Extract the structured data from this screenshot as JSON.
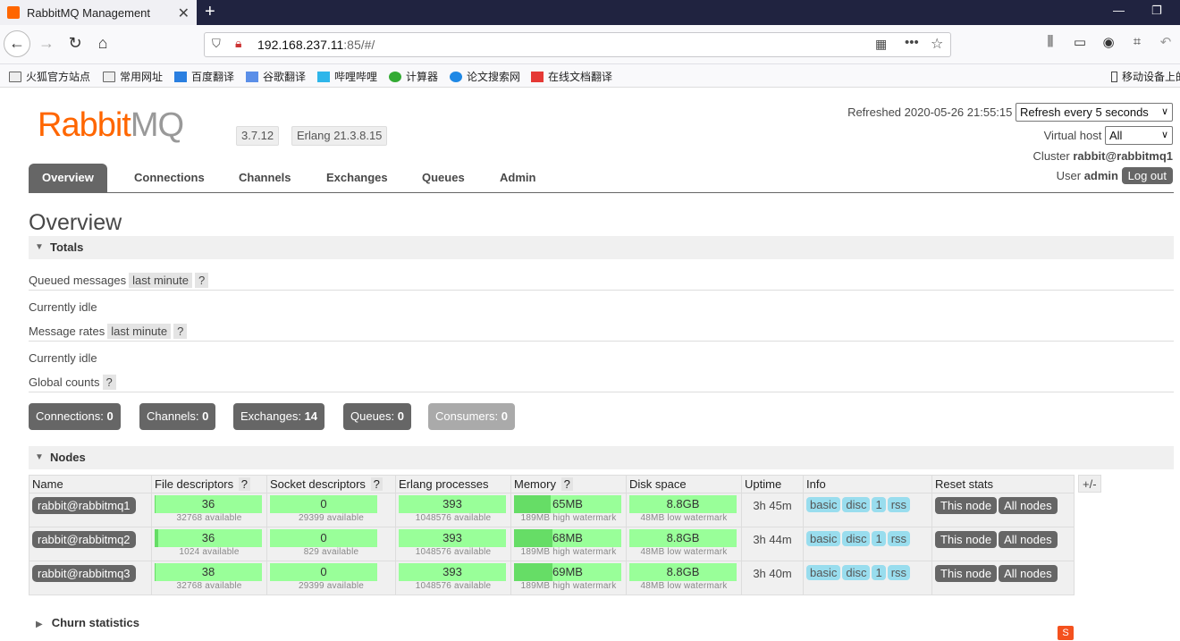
{
  "browser": {
    "tab_title": "RabbitMQ Management",
    "url_host": "192.168.237.11",
    "url_rest": ":85/#/",
    "bookmarks": [
      "火狐官方站点",
      "常用网址",
      "百度翻译",
      "谷歌翻译",
      "哔哩哔哩",
      "计算器",
      "论文搜索网",
      "在线文档翻译"
    ],
    "mobile_bookmarks": "移动设备上的"
  },
  "header": {
    "logo_rabbit": "Rabbit",
    "logo_mq": "MQ",
    "version": "3.7.12",
    "erlang": "Erlang 21.3.8.15",
    "refreshed": "Refreshed 2020-05-26 21:55:15",
    "refresh_select": "Refresh every 5 seconds",
    "vhost_label": "Virtual host",
    "vhost_value": "All",
    "cluster_label": "Cluster",
    "cluster_value": "rabbit@rabbitmq1",
    "user_label": "User",
    "user_value": "admin",
    "logout": "Log out"
  },
  "tabs": [
    "Overview",
    "Connections",
    "Channels",
    "Exchanges",
    "Queues",
    "Admin"
  ],
  "page_title": "Overview",
  "totals": {
    "title": "Totals",
    "queued_label": "Queued messages",
    "queued_hint": "last minute",
    "idle1": "Currently idle",
    "rates_label": "Message rates",
    "rates_hint": "last minute",
    "idle2": "Currently idle",
    "global_label": "Global counts",
    "help": "?"
  },
  "counts": [
    {
      "label": "Connections:",
      "value": "0"
    },
    {
      "label": "Channels:",
      "value": "0"
    },
    {
      "label": "Exchanges:",
      "value": "14"
    },
    {
      "label": "Queues:",
      "value": "0"
    },
    {
      "label": "Consumers:",
      "value": "0"
    }
  ],
  "nodes": {
    "title": "Nodes",
    "headers": [
      "Name",
      "File descriptors",
      "Socket descriptors",
      "Erlang processes",
      "Memory",
      "Disk space",
      "Uptime",
      "Info",
      "Reset stats"
    ],
    "plusminus": "+/-",
    "info_pills": [
      "basic",
      "disc",
      "1",
      "rss"
    ],
    "reset_buttons": [
      "This node",
      "All nodes"
    ],
    "rows": [
      {
        "name": "rabbit@rabbitmq1",
        "fd": "36",
        "fd_sub": "32768 available",
        "fd_frac": 0.01,
        "sd": "0",
        "sd_sub": "29399 available",
        "ep": "393",
        "ep_sub": "1048576 available",
        "mem": "65MB",
        "mem_sub": "189MB high watermark",
        "mem_frac": 0.34,
        "disk": "8.8GB",
        "disk_sub": "48MB low watermark",
        "uptime": "3h 45m"
      },
      {
        "name": "rabbit@rabbitmq2",
        "fd": "36",
        "fd_sub": "1024 available",
        "fd_frac": 0.035,
        "sd": "0",
        "sd_sub": "829 available",
        "ep": "393",
        "ep_sub": "1048576 available",
        "mem": "68MB",
        "mem_sub": "189MB high watermark",
        "mem_frac": 0.36,
        "disk": "8.8GB",
        "disk_sub": "48MB low watermark",
        "uptime": "3h 44m"
      },
      {
        "name": "rabbit@rabbitmq3",
        "fd": "38",
        "fd_sub": "32768 available",
        "fd_frac": 0.01,
        "sd": "0",
        "sd_sub": "29399 available",
        "ep": "393",
        "ep_sub": "1048576 available",
        "mem": "69MB",
        "mem_sub": "189MB high watermark",
        "mem_frac": 0.36,
        "disk": "8.8GB",
        "disk_sub": "48MB low watermark",
        "uptime": "3h 40m"
      }
    ]
  },
  "churn_title": "Churn statistics",
  "colors": {
    "brand": "#ff6600",
    "bar": "#99ff99",
    "bar_fill": "#66dd66",
    "pill": "#99ddee",
    "dark": "#666666"
  }
}
